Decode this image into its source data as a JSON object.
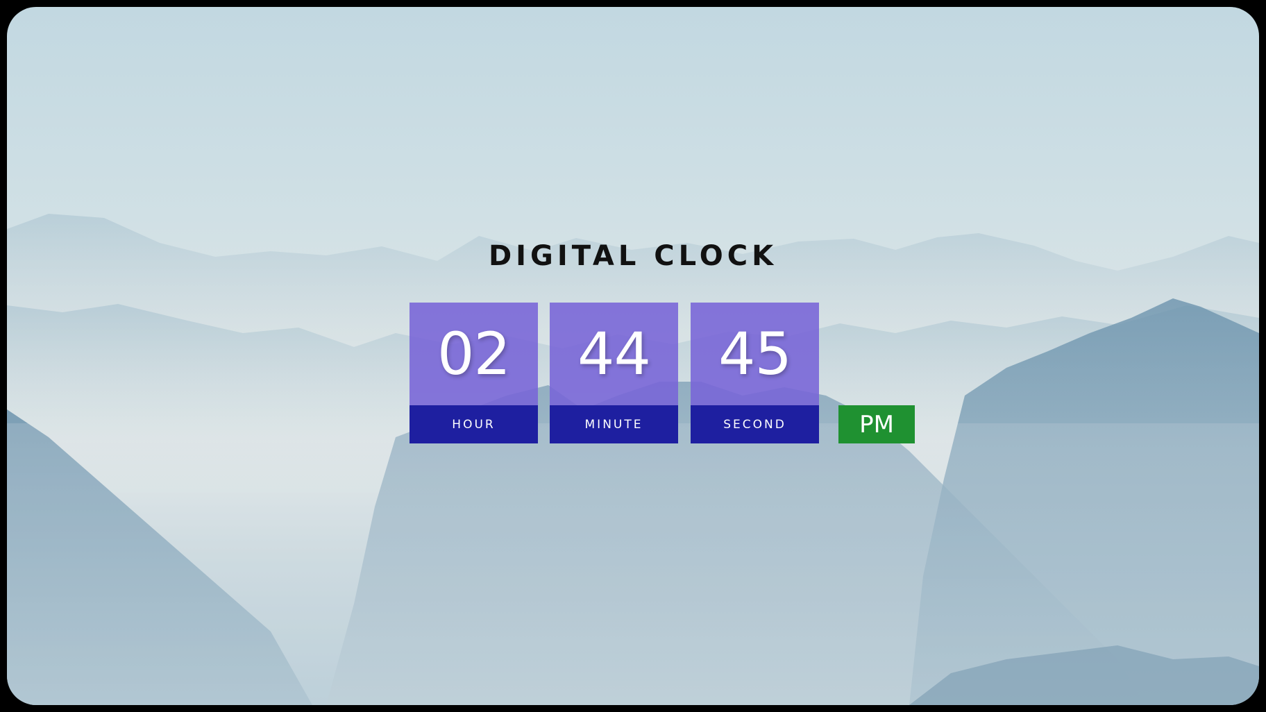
{
  "title": "DIGITAL CLOCK",
  "clock": {
    "hour": {
      "value": "02",
      "label": "HOUR"
    },
    "minute": {
      "value": "44",
      "label": "MINUTE"
    },
    "second": {
      "value": "45",
      "label": "SECOND"
    },
    "period": "PM"
  },
  "colors": {
    "digit_box": "#7c68d6",
    "label_box": "#1e1fa0",
    "period_box": "#1f9131",
    "title_text": "#111111"
  }
}
